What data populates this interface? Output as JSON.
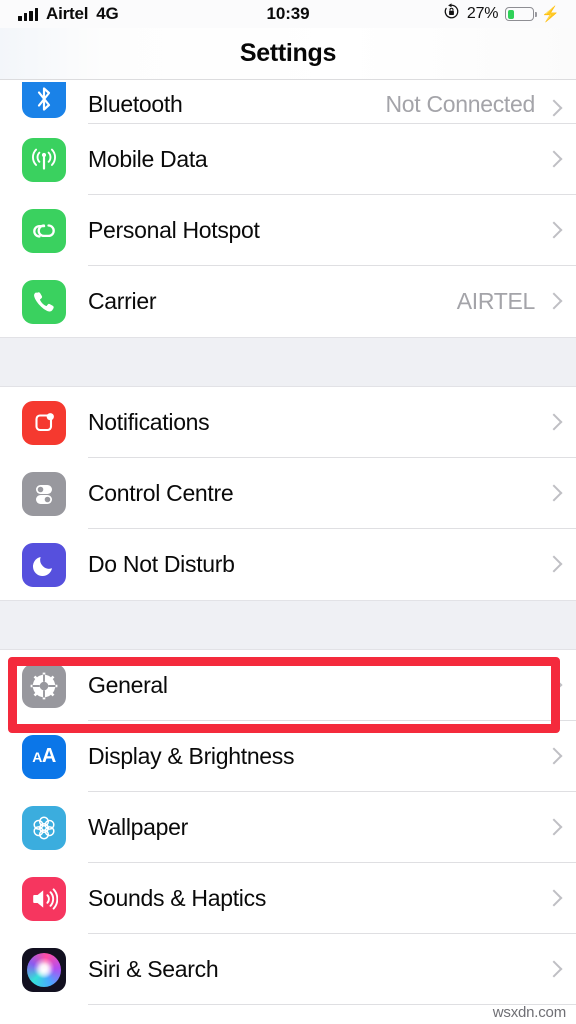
{
  "status_bar": {
    "carrier": "Airtel",
    "network": "4G",
    "time": "10:39",
    "battery_percent": "27%",
    "battery_level": 27,
    "charging": true,
    "rotation_lock": true,
    "signal_bars": 4,
    "icons": {
      "signal": "signal-bars-icon",
      "rotation_lock": "rotation-lock-icon",
      "battery": "battery-icon",
      "bolt": "charging-bolt-icon"
    }
  },
  "header": {
    "title": "Settings"
  },
  "groups": [
    {
      "id": "connectivity",
      "rows": [
        {
          "label": "Bluetooth",
          "value": "Not Connected",
          "icon": "bluetooth-icon",
          "clipped": true
        },
        {
          "label": "Mobile Data",
          "value": "",
          "icon": "mobile-data-icon",
          "clipped": false
        },
        {
          "label": "Personal Hotspot",
          "value": "",
          "icon": "personal-hotspot-icon",
          "clipped": false
        },
        {
          "label": "Carrier",
          "value": "AIRTEL",
          "icon": "carrier-phone-icon",
          "clipped": false
        }
      ]
    },
    {
      "id": "alerts",
      "rows": [
        {
          "label": "Notifications",
          "value": "",
          "icon": "notifications-icon",
          "clipped": false
        },
        {
          "label": "Control Centre",
          "value": "",
          "icon": "control-centre-icon",
          "clipped": false
        },
        {
          "label": "Do Not Disturb",
          "value": "",
          "icon": "do-not-disturb-icon",
          "clipped": false
        }
      ]
    },
    {
      "id": "system",
      "rows": [
        {
          "label": "General",
          "value": "",
          "icon": "gear-icon",
          "clipped": false,
          "highlighted": true
        },
        {
          "label": "Display & Brightness",
          "value": "",
          "icon": "display-brightness-icon",
          "clipped": false
        },
        {
          "label": "Wallpaper",
          "value": "",
          "icon": "wallpaper-icon",
          "clipped": false
        },
        {
          "label": "Sounds & Haptics",
          "value": "",
          "icon": "sounds-haptics-icon",
          "clipped": false
        },
        {
          "label": "Siri & Search",
          "value": "",
          "icon": "siri-search-icon",
          "clipped": false
        }
      ]
    }
  ],
  "annotation": {
    "target": "General",
    "color": "#f42a3c"
  },
  "watermark": "wsxdn.com",
  "colors": {
    "bluetooth": "#1a82e8",
    "green": "#3ad15f",
    "red": "#f5392f",
    "gray": "#98989e",
    "indigo": "#5650dd",
    "blue": "#0b76e8",
    "lightblue": "#3badde",
    "pink": "#f6365f",
    "siri_dark": "#121020",
    "battery_green": "#2fd158",
    "group_bg": "#eff0f4",
    "chevron": "#bfbfc4",
    "value_text": "#a4a4a9"
  }
}
